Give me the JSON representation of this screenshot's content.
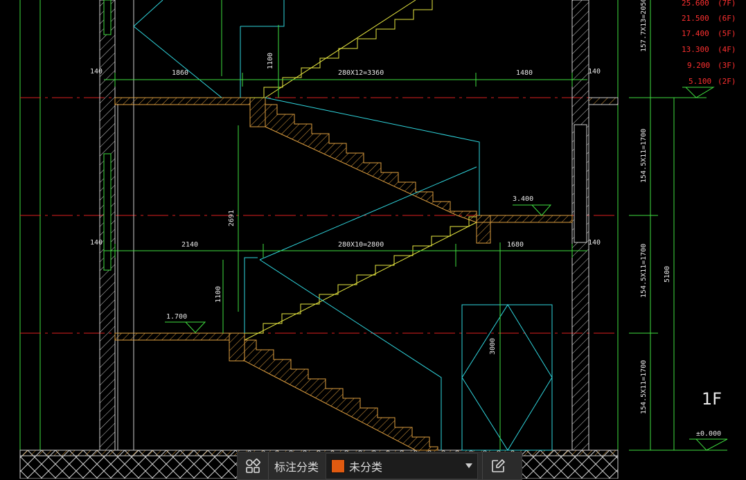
{
  "levels": {
    "items": [
      {
        "value": "25.600",
        "floor": "(7F)"
      },
      {
        "value": "21.500",
        "floor": "(6F)"
      },
      {
        "value": "17.400",
        "floor": "(5F)"
      },
      {
        "value": "13.300",
        "floor": "(4F)"
      },
      {
        "value": "9.200",
        "floor": "(3F)"
      },
      {
        "value": "5.100",
        "floor": "(2F)"
      }
    ]
  },
  "dims": {
    "d140_top_left": "140",
    "d1860": "1860",
    "d280x12": "280X12=3360",
    "d1480": "1480",
    "d140_top_right": "140",
    "d1100_upper": "1100",
    "d2691": "2691",
    "d3400": "3.400",
    "d140_mid_left": "140",
    "d2140": "2140",
    "d280x10": "280X10=2800",
    "d1680": "1680",
    "d140_mid_right": "140",
    "d1100_lower": "1100",
    "d1700": "1.700",
    "d3000": "3000",
    "d0000": "±0.000",
    "d1577": "157.7X13=2050",
    "d1545_a": "154.5X11=1700",
    "d1545_b": "154.5X11=1700",
    "d1545_c": "154.5X11=1700",
    "d5100": "5100"
  },
  "floor_label": "1F",
  "toolbar": {
    "label": "标注分类",
    "selected": "未分类",
    "swatch_color": "#e05a10"
  },
  "colors": {
    "dim_green": "#40e040",
    "axis_red": "#e02020",
    "stair_yellow": "#e8e840",
    "cyan": "#30d8e0",
    "hatch_orange": "#e0a040",
    "wall_white": "#d0d0d0"
  }
}
